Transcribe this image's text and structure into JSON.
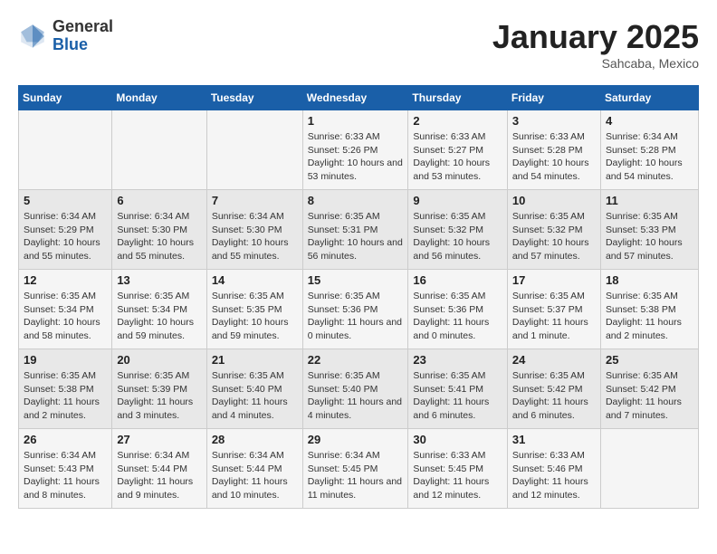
{
  "logo": {
    "general": "General",
    "blue": "Blue"
  },
  "title": "January 2025",
  "subtitle": "Sahcaba, Mexico",
  "days_of_week": [
    "Sunday",
    "Monday",
    "Tuesday",
    "Wednesday",
    "Thursday",
    "Friday",
    "Saturday"
  ],
  "weeks": [
    [
      {
        "day": "",
        "sunrise": "",
        "sunset": "",
        "daylight": ""
      },
      {
        "day": "",
        "sunrise": "",
        "sunset": "",
        "daylight": ""
      },
      {
        "day": "",
        "sunrise": "",
        "sunset": "",
        "daylight": ""
      },
      {
        "day": "1",
        "sunrise": "Sunrise: 6:33 AM",
        "sunset": "Sunset: 5:26 PM",
        "daylight": "Daylight: 10 hours and 53 minutes."
      },
      {
        "day": "2",
        "sunrise": "Sunrise: 6:33 AM",
        "sunset": "Sunset: 5:27 PM",
        "daylight": "Daylight: 10 hours and 53 minutes."
      },
      {
        "day": "3",
        "sunrise": "Sunrise: 6:33 AM",
        "sunset": "Sunset: 5:28 PM",
        "daylight": "Daylight: 10 hours and 54 minutes."
      },
      {
        "day": "4",
        "sunrise": "Sunrise: 6:34 AM",
        "sunset": "Sunset: 5:28 PM",
        "daylight": "Daylight: 10 hours and 54 minutes."
      }
    ],
    [
      {
        "day": "5",
        "sunrise": "Sunrise: 6:34 AM",
        "sunset": "Sunset: 5:29 PM",
        "daylight": "Daylight: 10 hours and 55 minutes."
      },
      {
        "day": "6",
        "sunrise": "Sunrise: 6:34 AM",
        "sunset": "Sunset: 5:30 PM",
        "daylight": "Daylight: 10 hours and 55 minutes."
      },
      {
        "day": "7",
        "sunrise": "Sunrise: 6:34 AM",
        "sunset": "Sunset: 5:30 PM",
        "daylight": "Daylight: 10 hours and 55 minutes."
      },
      {
        "day": "8",
        "sunrise": "Sunrise: 6:35 AM",
        "sunset": "Sunset: 5:31 PM",
        "daylight": "Daylight: 10 hours and 56 minutes."
      },
      {
        "day": "9",
        "sunrise": "Sunrise: 6:35 AM",
        "sunset": "Sunset: 5:32 PM",
        "daylight": "Daylight: 10 hours and 56 minutes."
      },
      {
        "day": "10",
        "sunrise": "Sunrise: 6:35 AM",
        "sunset": "Sunset: 5:32 PM",
        "daylight": "Daylight: 10 hours and 57 minutes."
      },
      {
        "day": "11",
        "sunrise": "Sunrise: 6:35 AM",
        "sunset": "Sunset: 5:33 PM",
        "daylight": "Daylight: 10 hours and 57 minutes."
      }
    ],
    [
      {
        "day": "12",
        "sunrise": "Sunrise: 6:35 AM",
        "sunset": "Sunset: 5:34 PM",
        "daylight": "Daylight: 10 hours and 58 minutes."
      },
      {
        "day": "13",
        "sunrise": "Sunrise: 6:35 AM",
        "sunset": "Sunset: 5:34 PM",
        "daylight": "Daylight: 10 hours and 59 minutes."
      },
      {
        "day": "14",
        "sunrise": "Sunrise: 6:35 AM",
        "sunset": "Sunset: 5:35 PM",
        "daylight": "Daylight: 10 hours and 59 minutes."
      },
      {
        "day": "15",
        "sunrise": "Sunrise: 6:35 AM",
        "sunset": "Sunset: 5:36 PM",
        "daylight": "Daylight: 11 hours and 0 minutes."
      },
      {
        "day": "16",
        "sunrise": "Sunrise: 6:35 AM",
        "sunset": "Sunset: 5:36 PM",
        "daylight": "Daylight: 11 hours and 0 minutes."
      },
      {
        "day": "17",
        "sunrise": "Sunrise: 6:35 AM",
        "sunset": "Sunset: 5:37 PM",
        "daylight": "Daylight: 11 hours and 1 minute."
      },
      {
        "day": "18",
        "sunrise": "Sunrise: 6:35 AM",
        "sunset": "Sunset: 5:38 PM",
        "daylight": "Daylight: 11 hours and 2 minutes."
      }
    ],
    [
      {
        "day": "19",
        "sunrise": "Sunrise: 6:35 AM",
        "sunset": "Sunset: 5:38 PM",
        "daylight": "Daylight: 11 hours and 2 minutes."
      },
      {
        "day": "20",
        "sunrise": "Sunrise: 6:35 AM",
        "sunset": "Sunset: 5:39 PM",
        "daylight": "Daylight: 11 hours and 3 minutes."
      },
      {
        "day": "21",
        "sunrise": "Sunrise: 6:35 AM",
        "sunset": "Sunset: 5:40 PM",
        "daylight": "Daylight: 11 hours and 4 minutes."
      },
      {
        "day": "22",
        "sunrise": "Sunrise: 6:35 AM",
        "sunset": "Sunset: 5:40 PM",
        "daylight": "Daylight: 11 hours and 4 minutes."
      },
      {
        "day": "23",
        "sunrise": "Sunrise: 6:35 AM",
        "sunset": "Sunset: 5:41 PM",
        "daylight": "Daylight: 11 hours and 6 minutes."
      },
      {
        "day": "24",
        "sunrise": "Sunrise: 6:35 AM",
        "sunset": "Sunset: 5:42 PM",
        "daylight": "Daylight: 11 hours and 6 minutes."
      },
      {
        "day": "25",
        "sunrise": "Sunrise: 6:35 AM",
        "sunset": "Sunset: 5:42 PM",
        "daylight": "Daylight: 11 hours and 7 minutes."
      }
    ],
    [
      {
        "day": "26",
        "sunrise": "Sunrise: 6:34 AM",
        "sunset": "Sunset: 5:43 PM",
        "daylight": "Daylight: 11 hours and 8 minutes."
      },
      {
        "day": "27",
        "sunrise": "Sunrise: 6:34 AM",
        "sunset": "Sunset: 5:44 PM",
        "daylight": "Daylight: 11 hours and 9 minutes."
      },
      {
        "day": "28",
        "sunrise": "Sunrise: 6:34 AM",
        "sunset": "Sunset: 5:44 PM",
        "daylight": "Daylight: 11 hours and 10 minutes."
      },
      {
        "day": "29",
        "sunrise": "Sunrise: 6:34 AM",
        "sunset": "Sunset: 5:45 PM",
        "daylight": "Daylight: 11 hours and 11 minutes."
      },
      {
        "day": "30",
        "sunrise": "Sunrise: 6:33 AM",
        "sunset": "Sunset: 5:45 PM",
        "daylight": "Daylight: 11 hours and 12 minutes."
      },
      {
        "day": "31",
        "sunrise": "Sunrise: 6:33 AM",
        "sunset": "Sunset: 5:46 PM",
        "daylight": "Daylight: 11 hours and 12 minutes."
      },
      {
        "day": "",
        "sunrise": "",
        "sunset": "",
        "daylight": ""
      }
    ]
  ]
}
